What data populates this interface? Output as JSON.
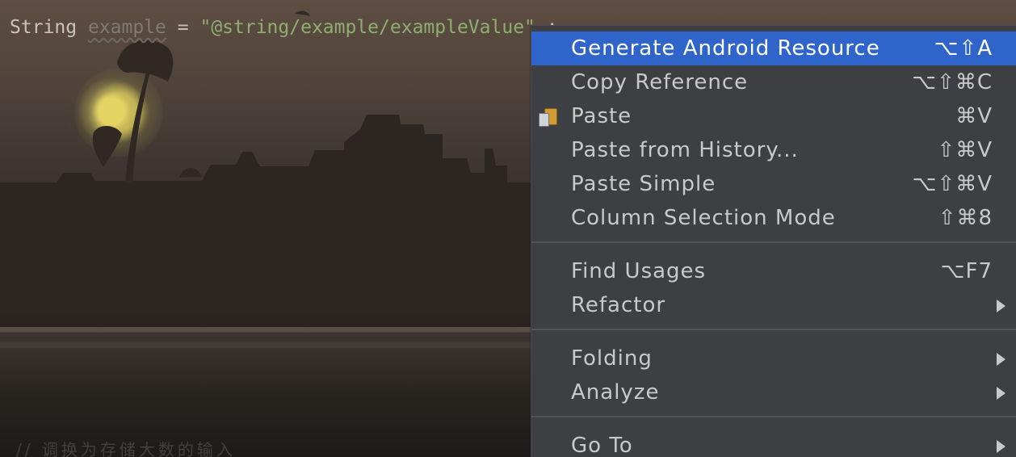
{
  "editor": {
    "code": {
      "type": "String",
      "variable": "example",
      "operator": "=",
      "string": "\"@string/example/exampleValue\"",
      "terminator": ";"
    },
    "bottom_text": "//  调换为存储大数的输入"
  },
  "context_menu": {
    "items": [
      {
        "label": "Generate Android Resource",
        "shortcut": "⌥⇧A",
        "selected": true
      },
      {
        "label": "Copy Reference",
        "shortcut": "⌥⇧⌘C"
      },
      {
        "label": "Paste",
        "shortcut": "⌘V",
        "icon": "paste-icon"
      },
      {
        "label": "Paste from History...",
        "shortcut": "⇧⌘V"
      },
      {
        "label": "Paste Simple",
        "shortcut": "⌥⇧⌘V"
      },
      {
        "label": "Column Selection Mode",
        "shortcut": "⇧⌘8"
      },
      {
        "label": "Find Usages",
        "shortcut": "⌥F7"
      },
      {
        "label": "Refactor",
        "submenu": true
      },
      {
        "label": "Folding",
        "submenu": true
      },
      {
        "label": "Analyze",
        "submenu": true
      },
      {
        "label": "Go To",
        "submenu": true
      }
    ]
  },
  "colors": {
    "menu_background": "#3d3f42",
    "menu_selection": "#2f65ca",
    "menu_text": "#c9c9c9",
    "string_literal": "#8fae70"
  }
}
